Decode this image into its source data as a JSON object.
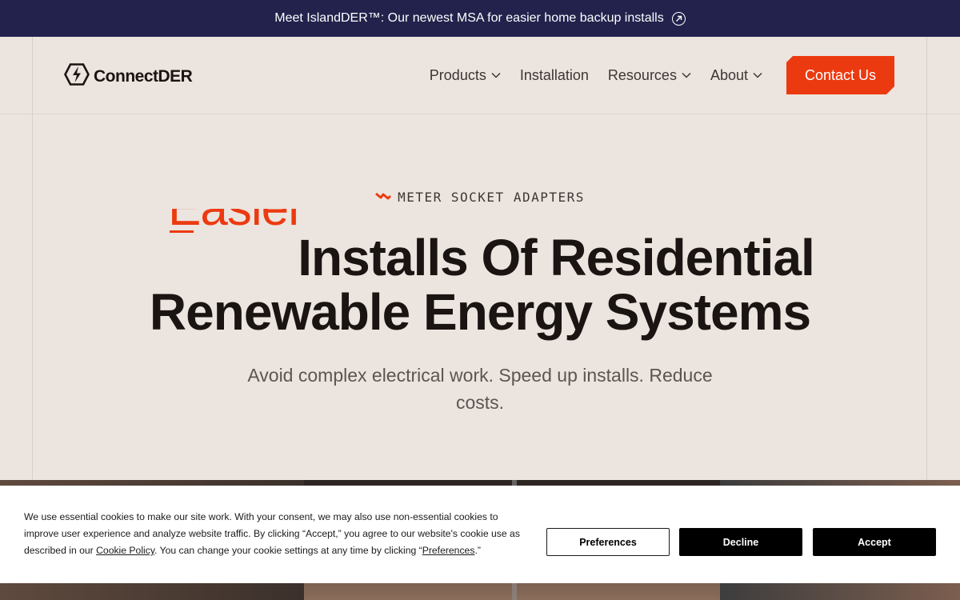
{
  "announcement": {
    "text": "Meet IslandDER™: Our newest MSA for easier home backup installs"
  },
  "header": {
    "logo_text": "ConnectDER",
    "nav": [
      {
        "label": "Products",
        "has_dropdown": true
      },
      {
        "label": "Installation",
        "has_dropdown": false
      },
      {
        "label": "Resources",
        "has_dropdown": true
      },
      {
        "label": "About",
        "has_dropdown": true
      }
    ],
    "contact_label": "Contact Us"
  },
  "hero": {
    "eyebrow": "METER SOCKET ADAPTERS",
    "animated_word": "Easier",
    "headline_line1": "Installs Of Residential",
    "headline_line2": "Renewable Energy Systems",
    "subtext": "Avoid complex electrical work. Speed up installs. Reduce costs."
  },
  "cookie_banner": {
    "text_before_link": "We use essential cookies to make our site work. With your consent, we may also use non-essential cookies to improve user experience and analyze website traffic. By clicking “Accept,” you agree to our website's cookie use as described in our ",
    "cookie_policy_link": "Cookie Policy",
    "text_middle": ". You can change your cookie settings at any time by clicking “",
    "preferences_link": "Preferences",
    "text_end": ".”",
    "buttons": {
      "preferences": "Preferences",
      "decline": "Decline",
      "accept": "Accept"
    }
  },
  "colors": {
    "accent": "#ec3a10",
    "announce_bg": "#22224d",
    "page_bg": "#ece4df"
  },
  "icons": {
    "announce": "arrow-up-right-circle-icon",
    "logo": "bolt-hexagon-icon",
    "nav_dropdown": "chevron-down-icon",
    "eyebrow": "zigzag-bolt-icon"
  }
}
